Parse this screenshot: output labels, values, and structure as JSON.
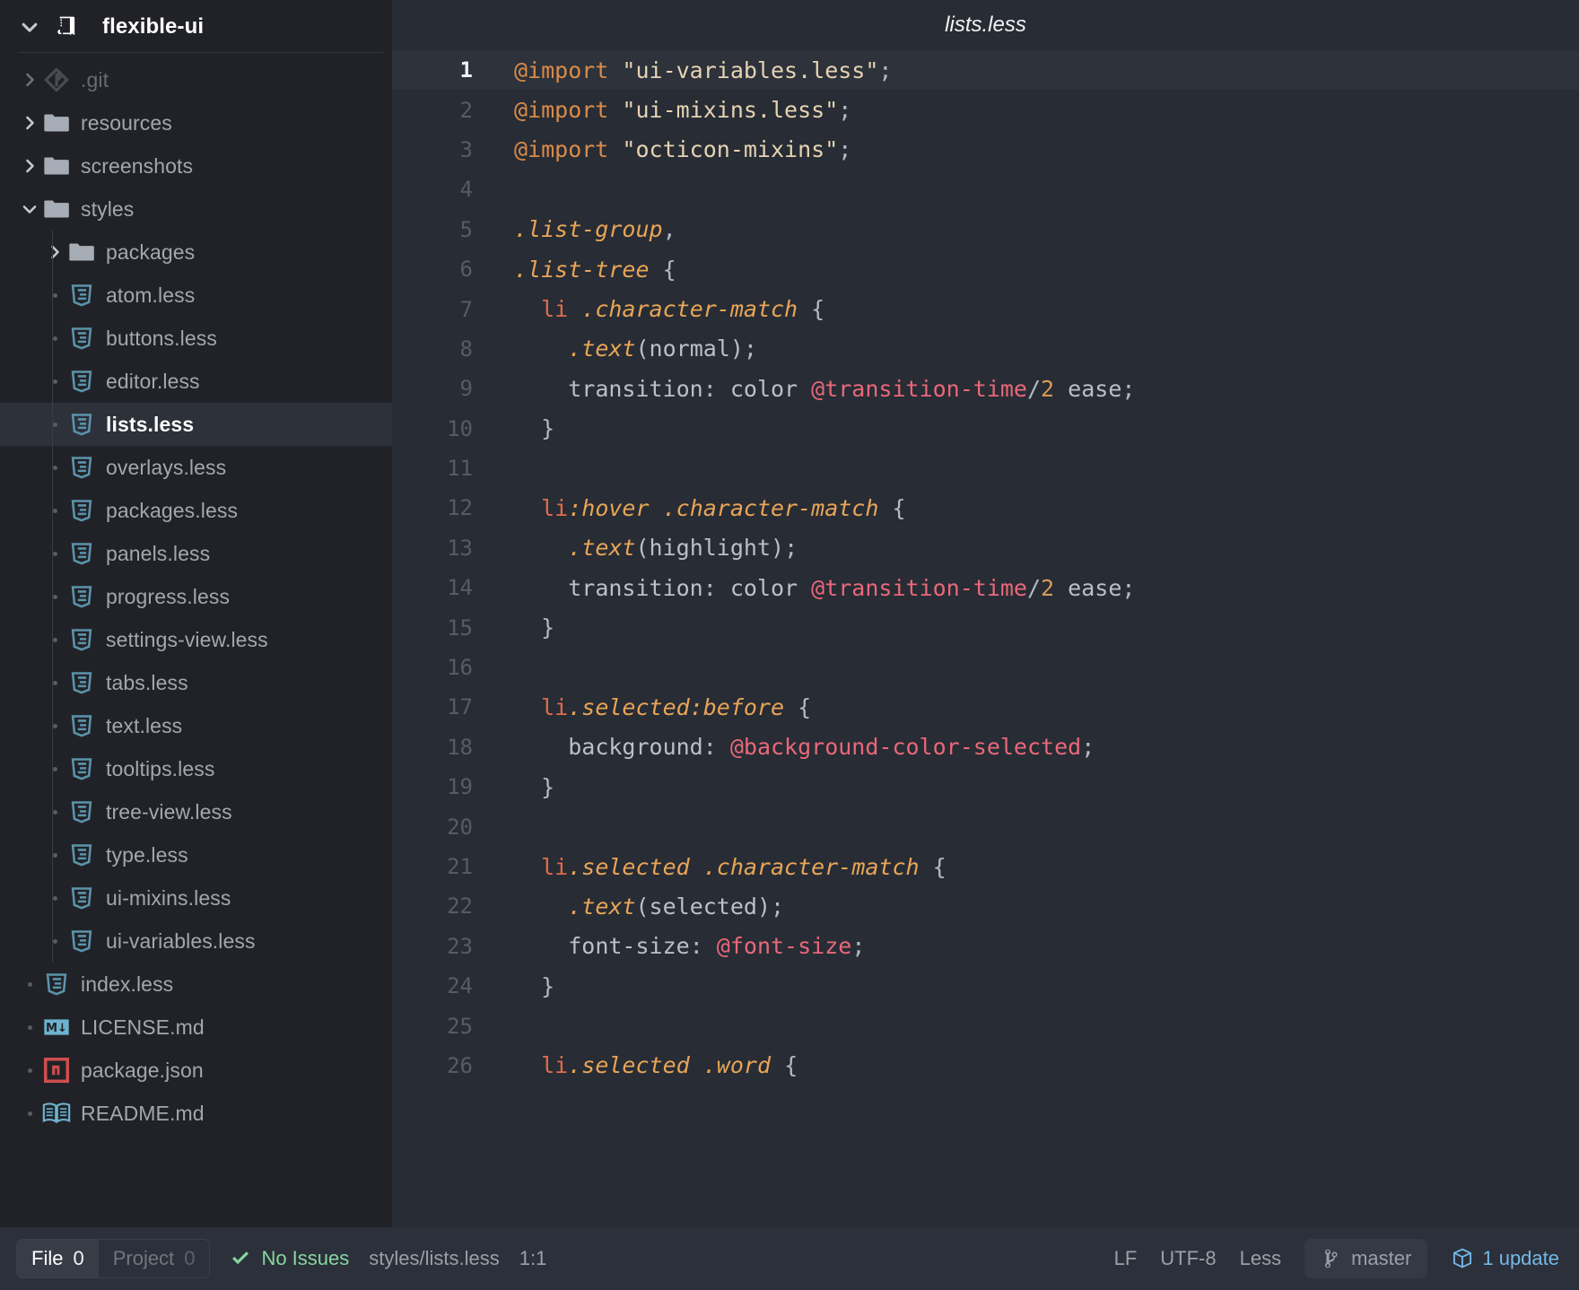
{
  "theme": {
    "sidebar_bg": "#212227",
    "editor_bg": "#282c34",
    "statusbar_bg": "#2c303a",
    "accent_blue": "#74b8e8",
    "accent_green": "#87d6a0",
    "selected_row_bg": "#2c313a"
  },
  "sidebar": {
    "project": {
      "name": "flexible-ui",
      "icon": "repo-icon",
      "expanded": true
    },
    "items": [
      {
        "label": ".git",
        "icon": "git-icon",
        "type": "folder",
        "depth": 1,
        "twisty": "collapsed",
        "muted": true
      },
      {
        "label": "resources",
        "icon": "folder-icon",
        "type": "folder",
        "depth": 1,
        "twisty": "collapsed",
        "muted": false
      },
      {
        "label": "screenshots",
        "icon": "folder-icon",
        "type": "folder",
        "depth": 1,
        "twisty": "collapsed",
        "muted": false
      },
      {
        "label": "styles",
        "icon": "folder-icon",
        "type": "folder",
        "depth": 1,
        "twisty": "expanded",
        "muted": false
      },
      {
        "label": "packages",
        "icon": "folder-icon",
        "type": "folder",
        "depth": 2,
        "twisty": "collapsed",
        "muted": false
      },
      {
        "label": "atom.less",
        "icon": "less-icon",
        "type": "file",
        "depth": 2,
        "twisty": "none",
        "muted": false
      },
      {
        "label": "buttons.less",
        "icon": "less-icon",
        "type": "file",
        "depth": 2,
        "twisty": "none",
        "muted": false
      },
      {
        "label": "editor.less",
        "icon": "less-icon",
        "type": "file",
        "depth": 2,
        "twisty": "none",
        "muted": false
      },
      {
        "label": "lists.less",
        "icon": "less-icon",
        "type": "file",
        "depth": 2,
        "twisty": "none",
        "muted": false,
        "selected": true
      },
      {
        "label": "overlays.less",
        "icon": "less-icon",
        "type": "file",
        "depth": 2,
        "twisty": "none",
        "muted": false
      },
      {
        "label": "packages.less",
        "icon": "less-icon",
        "type": "file",
        "depth": 2,
        "twisty": "none",
        "muted": false
      },
      {
        "label": "panels.less",
        "icon": "less-icon",
        "type": "file",
        "depth": 2,
        "twisty": "none",
        "muted": false
      },
      {
        "label": "progress.less",
        "icon": "less-icon",
        "type": "file",
        "depth": 2,
        "twisty": "none",
        "muted": false
      },
      {
        "label": "settings-view.less",
        "icon": "less-icon",
        "type": "file",
        "depth": 2,
        "twisty": "none",
        "muted": false
      },
      {
        "label": "tabs.less",
        "icon": "less-icon",
        "type": "file",
        "depth": 2,
        "twisty": "none",
        "muted": false
      },
      {
        "label": "text.less",
        "icon": "less-icon",
        "type": "file",
        "depth": 2,
        "twisty": "none",
        "muted": false
      },
      {
        "label": "tooltips.less",
        "icon": "less-icon",
        "type": "file",
        "depth": 2,
        "twisty": "none",
        "muted": false
      },
      {
        "label": "tree-view.less",
        "icon": "less-icon",
        "type": "file",
        "depth": 2,
        "twisty": "none",
        "muted": false
      },
      {
        "label": "type.less",
        "icon": "less-icon",
        "type": "file",
        "depth": 2,
        "twisty": "none",
        "muted": false
      },
      {
        "label": "ui-mixins.less",
        "icon": "less-icon",
        "type": "file",
        "depth": 2,
        "twisty": "none",
        "muted": false
      },
      {
        "label": "ui-variables.less",
        "icon": "less-icon",
        "type": "file",
        "depth": 2,
        "twisty": "none",
        "muted": false
      },
      {
        "label": "index.less",
        "icon": "less-icon",
        "type": "file",
        "depth": 1,
        "twisty": "none",
        "muted": false
      },
      {
        "label": "LICENSE.md",
        "icon": "markdown-icon",
        "type": "file",
        "depth": 1,
        "twisty": "none",
        "muted": false
      },
      {
        "label": "package.json",
        "icon": "npm-icon",
        "type": "file",
        "depth": 1,
        "twisty": "none",
        "muted": false
      },
      {
        "label": "README.md",
        "icon": "book-icon",
        "type": "file",
        "depth": 1,
        "twisty": "none",
        "muted": false
      }
    ]
  },
  "editor": {
    "title": "lists.less",
    "active_line": 1,
    "lines": [
      {
        "n": "1",
        "tokens": [
          {
            "t": "@import",
            "c": "t-at"
          },
          {
            "t": " ",
            "c": "t-plain"
          },
          {
            "t": "\"ui-variables.less\"",
            "c": "t-str"
          },
          {
            "t": ";",
            "c": "t-pun"
          }
        ]
      },
      {
        "n": "2",
        "tokens": [
          {
            "t": "@import",
            "c": "t-at"
          },
          {
            "t": " ",
            "c": "t-plain"
          },
          {
            "t": "\"ui-mixins.less\"",
            "c": "t-str"
          },
          {
            "t": ";",
            "c": "t-pun"
          }
        ]
      },
      {
        "n": "3",
        "tokens": [
          {
            "t": "@import",
            "c": "t-at"
          },
          {
            "t": " ",
            "c": "t-plain"
          },
          {
            "t": "\"octicon-mixins\"",
            "c": "t-str"
          },
          {
            "t": ";",
            "c": "t-pun"
          }
        ]
      },
      {
        "n": "4",
        "tokens": []
      },
      {
        "n": "5",
        "tokens": [
          {
            "t": ".list-group",
            "c": "t-sel"
          },
          {
            "t": ",",
            "c": "t-pun"
          }
        ]
      },
      {
        "n": "6",
        "tokens": [
          {
            "t": ".list-tree",
            "c": "t-sel"
          },
          {
            "t": " {",
            "c": "t-pun"
          }
        ]
      },
      {
        "n": "7",
        "tokens": [
          {
            "t": "  ",
            "c": "t-plain"
          },
          {
            "t": "li",
            "c": "t-tag"
          },
          {
            "t": " ",
            "c": "t-plain"
          },
          {
            "t": ".character-match",
            "c": "t-sel"
          },
          {
            "t": " {",
            "c": "t-pun"
          }
        ]
      },
      {
        "n": "8",
        "tokens": [
          {
            "t": "    ",
            "c": "t-plain"
          },
          {
            "t": ".text",
            "c": "t-fn"
          },
          {
            "t": "(normal)",
            "c": "t-plain"
          },
          {
            "t": ";",
            "c": "t-pun"
          }
        ]
      },
      {
        "n": "9",
        "tokens": [
          {
            "t": "    ",
            "c": "t-plain"
          },
          {
            "t": "transition",
            "c": "t-prop"
          },
          {
            "t": ": ",
            "c": "t-pun"
          },
          {
            "t": "color ",
            "c": "t-prop"
          },
          {
            "t": "@transition-time",
            "c": "t-var"
          },
          {
            "t": "/",
            "c": "t-pun"
          },
          {
            "t": "2",
            "c": "t-num"
          },
          {
            "t": " ease",
            "c": "t-prop"
          },
          {
            "t": ";",
            "c": "t-pun"
          }
        ]
      },
      {
        "n": "10",
        "tokens": [
          {
            "t": "  }",
            "c": "t-pun"
          }
        ]
      },
      {
        "n": "11",
        "tokens": []
      },
      {
        "n": "12",
        "tokens": [
          {
            "t": "  ",
            "c": "t-plain"
          },
          {
            "t": "li",
            "c": "t-tag"
          },
          {
            "t": ":hover",
            "c": "t-sel"
          },
          {
            "t": " ",
            "c": "t-plain"
          },
          {
            "t": ".character-match",
            "c": "t-sel"
          },
          {
            "t": " {",
            "c": "t-pun"
          }
        ]
      },
      {
        "n": "13",
        "tokens": [
          {
            "t": "    ",
            "c": "t-plain"
          },
          {
            "t": ".text",
            "c": "t-fn"
          },
          {
            "t": "(highlight)",
            "c": "t-plain"
          },
          {
            "t": ";",
            "c": "t-pun"
          }
        ]
      },
      {
        "n": "14",
        "tokens": [
          {
            "t": "    ",
            "c": "t-plain"
          },
          {
            "t": "transition",
            "c": "t-prop"
          },
          {
            "t": ": ",
            "c": "t-pun"
          },
          {
            "t": "color ",
            "c": "t-prop"
          },
          {
            "t": "@transition-time",
            "c": "t-var"
          },
          {
            "t": "/",
            "c": "t-pun"
          },
          {
            "t": "2",
            "c": "t-num"
          },
          {
            "t": " ease",
            "c": "t-prop"
          },
          {
            "t": ";",
            "c": "t-pun"
          }
        ]
      },
      {
        "n": "15",
        "tokens": [
          {
            "t": "  }",
            "c": "t-pun"
          }
        ]
      },
      {
        "n": "16",
        "tokens": []
      },
      {
        "n": "17",
        "tokens": [
          {
            "t": "  ",
            "c": "t-plain"
          },
          {
            "t": "li",
            "c": "t-tag"
          },
          {
            "t": ".selected:before",
            "c": "t-sel"
          },
          {
            "t": " {",
            "c": "t-pun"
          }
        ]
      },
      {
        "n": "18",
        "tokens": [
          {
            "t": "    ",
            "c": "t-plain"
          },
          {
            "t": "background",
            "c": "t-prop"
          },
          {
            "t": ": ",
            "c": "t-pun"
          },
          {
            "t": "@background-color-selected",
            "c": "t-var"
          },
          {
            "t": ";",
            "c": "t-pun"
          }
        ]
      },
      {
        "n": "19",
        "tokens": [
          {
            "t": "  }",
            "c": "t-pun"
          }
        ]
      },
      {
        "n": "20",
        "tokens": []
      },
      {
        "n": "21",
        "tokens": [
          {
            "t": "  ",
            "c": "t-plain"
          },
          {
            "t": "li",
            "c": "t-tag"
          },
          {
            "t": ".selected",
            "c": "t-sel"
          },
          {
            "t": " ",
            "c": "t-plain"
          },
          {
            "t": ".character-match",
            "c": "t-sel"
          },
          {
            "t": " {",
            "c": "t-pun"
          }
        ]
      },
      {
        "n": "22",
        "tokens": [
          {
            "t": "    ",
            "c": "t-plain"
          },
          {
            "t": ".text",
            "c": "t-fn"
          },
          {
            "t": "(selected)",
            "c": "t-plain"
          },
          {
            "t": ";",
            "c": "t-pun"
          }
        ]
      },
      {
        "n": "23",
        "tokens": [
          {
            "t": "    ",
            "c": "t-plain"
          },
          {
            "t": "font-size",
            "c": "t-prop"
          },
          {
            "t": ": ",
            "c": "t-pun"
          },
          {
            "t": "@font-size",
            "c": "t-var"
          },
          {
            "t": ";",
            "c": "t-pun"
          }
        ]
      },
      {
        "n": "24",
        "tokens": [
          {
            "t": "  }",
            "c": "t-pun"
          }
        ]
      },
      {
        "n": "25",
        "tokens": []
      },
      {
        "n": "26",
        "tokens": [
          {
            "t": "  ",
            "c": "t-plain"
          },
          {
            "t": "li",
            "c": "t-tag"
          },
          {
            "t": ".selected",
            "c": "t-sel"
          },
          {
            "t": " ",
            "c": "t-plain"
          },
          {
            "t": ".word",
            "c": "t-sel"
          },
          {
            "t": " {",
            "c": "t-pun"
          }
        ]
      }
    ]
  },
  "status_bar": {
    "file_tab_label": "File",
    "file_tab_count": "0",
    "project_tab_label": "Project",
    "project_tab_count": "0",
    "issues_text": "No Issues",
    "issues_icon": "check-icon",
    "file_path": "styles/lists.less",
    "cursor_position": "1:1",
    "line_ending": "LF",
    "encoding": "UTF-8",
    "grammar": "Less",
    "branch": "master",
    "branch_icon": "git-branch-icon",
    "updates": "1 update",
    "updates_icon": "package-icon"
  }
}
